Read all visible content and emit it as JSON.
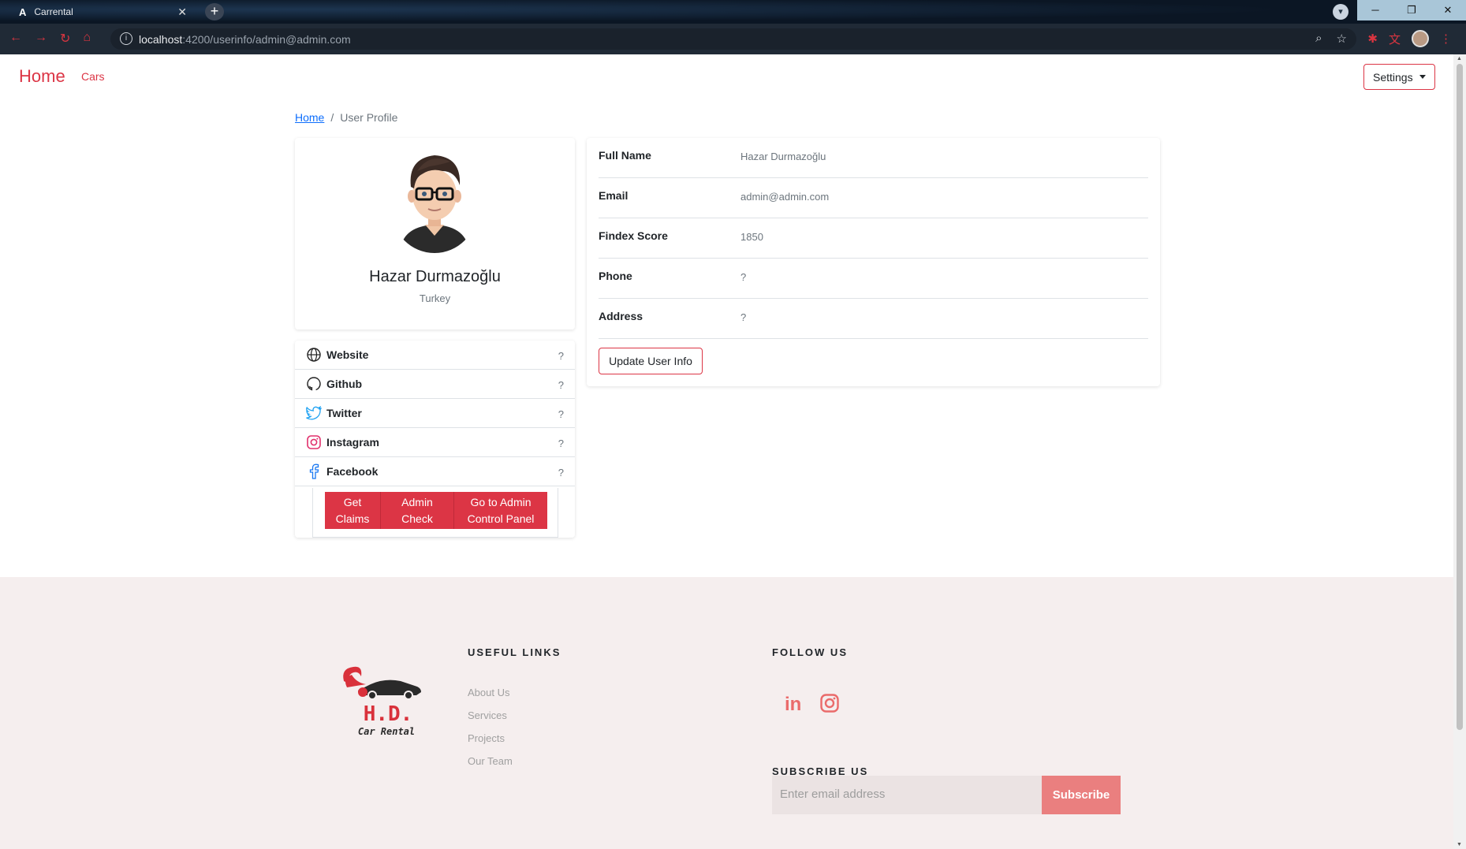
{
  "browser": {
    "tab_title": "Carrental",
    "tab_logo": "A",
    "url_host": "localhost",
    "url_rest": ":4200/userinfo/admin@admin.com"
  },
  "navbar": {
    "brand": "Home",
    "cars_link": "Cars",
    "settings_label": "Settings"
  },
  "breadcrumb": {
    "home": "Home",
    "separator": "/",
    "current": "User Profile"
  },
  "profile": {
    "name": "Hazar Durmazoğlu",
    "country": "Turkey"
  },
  "social_links": [
    {
      "label": "Website",
      "value": "?",
      "icon": "globe-icon"
    },
    {
      "label": "Github",
      "value": "?",
      "icon": "github-icon"
    },
    {
      "label": "Twitter",
      "value": "?",
      "icon": "twitter-icon"
    },
    {
      "label": "Instagram",
      "value": "?",
      "icon": "instagram-icon"
    },
    {
      "label": "Facebook",
      "value": "?",
      "icon": "facebook-icon"
    }
  ],
  "action_buttons": {
    "get_claims": "Get Claims",
    "admin_check": "Admin Check",
    "admin_panel": "Go to Admin Control Panel"
  },
  "user_info": [
    {
      "label": "Full Name",
      "value": "Hazar Durmazoğlu"
    },
    {
      "label": "Email",
      "value": "admin@admin.com"
    },
    {
      "label": "Findex Score",
      "value": "1850"
    },
    {
      "label": "Phone",
      "value": "?"
    },
    {
      "label": "Address",
      "value": "?"
    }
  ],
  "update_button": "Update User Info",
  "footer": {
    "logo_title": "H.D.",
    "logo_subtitle": "Car Rental",
    "useful_links_heading": "USEFUL LINKS",
    "useful_links": [
      "About Us",
      "Services",
      "Projects",
      "Our Team"
    ],
    "follow_heading": "FOLLOW US",
    "subscribe_heading": "SUBSCRIBE US",
    "email_placeholder": "Enter email address",
    "subscribe_button": "Subscribe"
  },
  "colors": {
    "accent": "#dc3545",
    "footer_bg": "#f5eeee",
    "subscribe": "#ea7f7f"
  }
}
